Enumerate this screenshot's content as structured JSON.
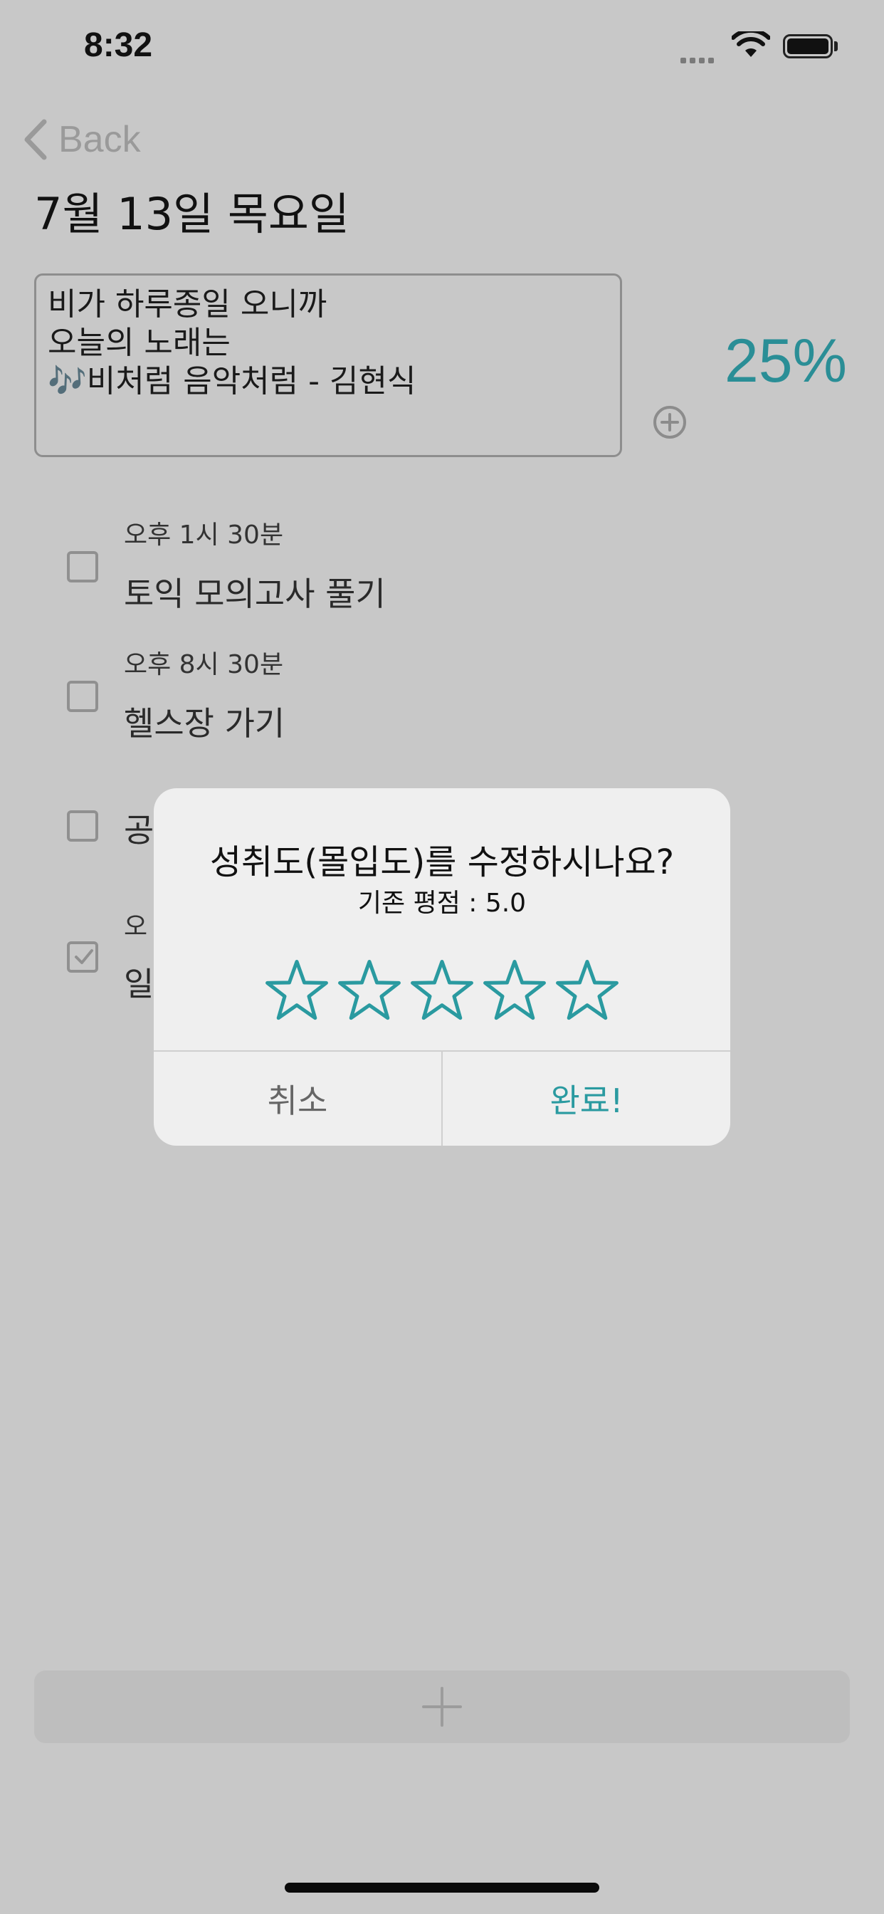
{
  "status_bar": {
    "time": "8:32"
  },
  "nav": {
    "back_label": "Back"
  },
  "page": {
    "title": "7월 13일 목요일"
  },
  "memo": {
    "lines": [
      "비가 하루종일 오니까",
      "오늘의 노래는",
      "🎶비처럼 음악처럼 - 김현식"
    ]
  },
  "progress": {
    "percent_label": "25%"
  },
  "tasks": [
    {
      "time": "오후 1시 30분",
      "title": "토익 모의고사 풀기",
      "checked": false
    },
    {
      "time": "오후 8시 30분",
      "title": "헬스장 가기",
      "checked": false
    },
    {
      "time": "",
      "title": "공",
      "checked": false
    },
    {
      "time": "오",
      "title": "일",
      "checked": true
    }
  ],
  "alert": {
    "title": "성취도(몰입도)를 수정하시나요?",
    "message": "기존 평점 : 5.0",
    "rating": 0,
    "max_rating": 5,
    "cancel_label": "취소",
    "done_label": "완료!"
  },
  "colors": {
    "accent": "#2a9aa0",
    "background": "#c8c8c8"
  },
  "icons": [
    "chevron-left-icon",
    "plus-circle-icon",
    "star-outline-icon",
    "plus-icon",
    "wifi-icon",
    "battery-icon"
  ]
}
